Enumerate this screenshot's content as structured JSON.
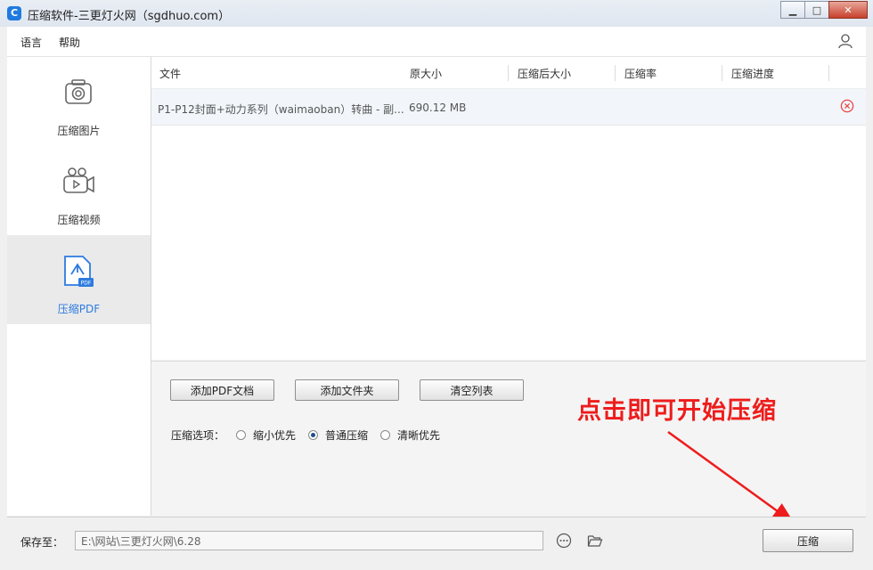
{
  "window": {
    "title": "压缩软件-三更灯火网（sgdhuo.com）",
    "app_icon": "C",
    "controls": {
      "minimize": "▁",
      "maximize": "□",
      "close": "✕"
    }
  },
  "menu": {
    "language": "语言",
    "help": "帮助",
    "user_icon": "user-icon"
  },
  "sidebar": {
    "items": [
      {
        "label": "压缩图片",
        "icon": "image-icon",
        "active": false
      },
      {
        "label": "压缩视频",
        "icon": "video-camera-icon",
        "active": false
      },
      {
        "label": "压缩PDF",
        "icon": "pdf-icon",
        "active": true,
        "icon_badge": "PDF"
      }
    ]
  },
  "table": {
    "columns": [
      "文件",
      "原大小",
      "压缩后大小",
      "压缩率",
      "压缩进度"
    ],
    "rows": [
      {
        "file": "P1-P12封面+动力系列（waimaoban）转曲 - 副...",
        "original_size": "690.12 MB",
        "compressed_size": "",
        "ratio": "",
        "progress": ""
      }
    ]
  },
  "actions": {
    "add_pdf": "添加PDF文档",
    "add_folder": "添加文件夹",
    "clear_list": "清空列表"
  },
  "options": {
    "label": "压缩选项：",
    "choices": [
      {
        "label": "缩小优先",
        "checked": false
      },
      {
        "label": "普通压缩",
        "checked": true
      },
      {
        "label": "清晰优先",
        "checked": false
      }
    ]
  },
  "annotation": {
    "text": "点击即可开始压缩",
    "color": "#ee1c1c"
  },
  "footer": {
    "save_label": "保存至：",
    "save_path": "E:\\网站\\三更灯火网\\6.28",
    "compress_button": "压缩"
  },
  "colors": {
    "accent": "#2d7be0",
    "remove": "#e84545"
  }
}
